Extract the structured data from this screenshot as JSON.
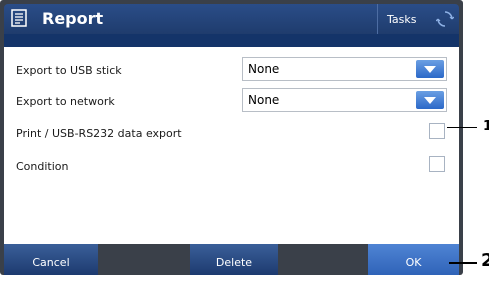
{
  "header": {
    "title": "Report",
    "tasks_label": "Tasks",
    "icons": {
      "app": "report-icon",
      "sync": "sync-icon"
    }
  },
  "rows": [
    {
      "label": "Export to USB stick",
      "type": "dropdown",
      "value": "None"
    },
    {
      "label": "Export to network",
      "type": "dropdown",
      "value": "None"
    },
    {
      "label": "Print / USB-RS232 data export",
      "type": "checkbox",
      "checked": false
    },
    {
      "label": "Condition",
      "type": "checkbox",
      "checked": false
    }
  ],
  "footer": {
    "cancel_label": "Cancel",
    "delete_label": "Delete",
    "ok_label": "OK"
  },
  "callouts": {
    "checkbox_marker": "1",
    "ok_marker": "2"
  },
  "colors": {
    "header": "#1f3c6d",
    "accent": "#2f63b8",
    "frame": "#3a4049"
  }
}
